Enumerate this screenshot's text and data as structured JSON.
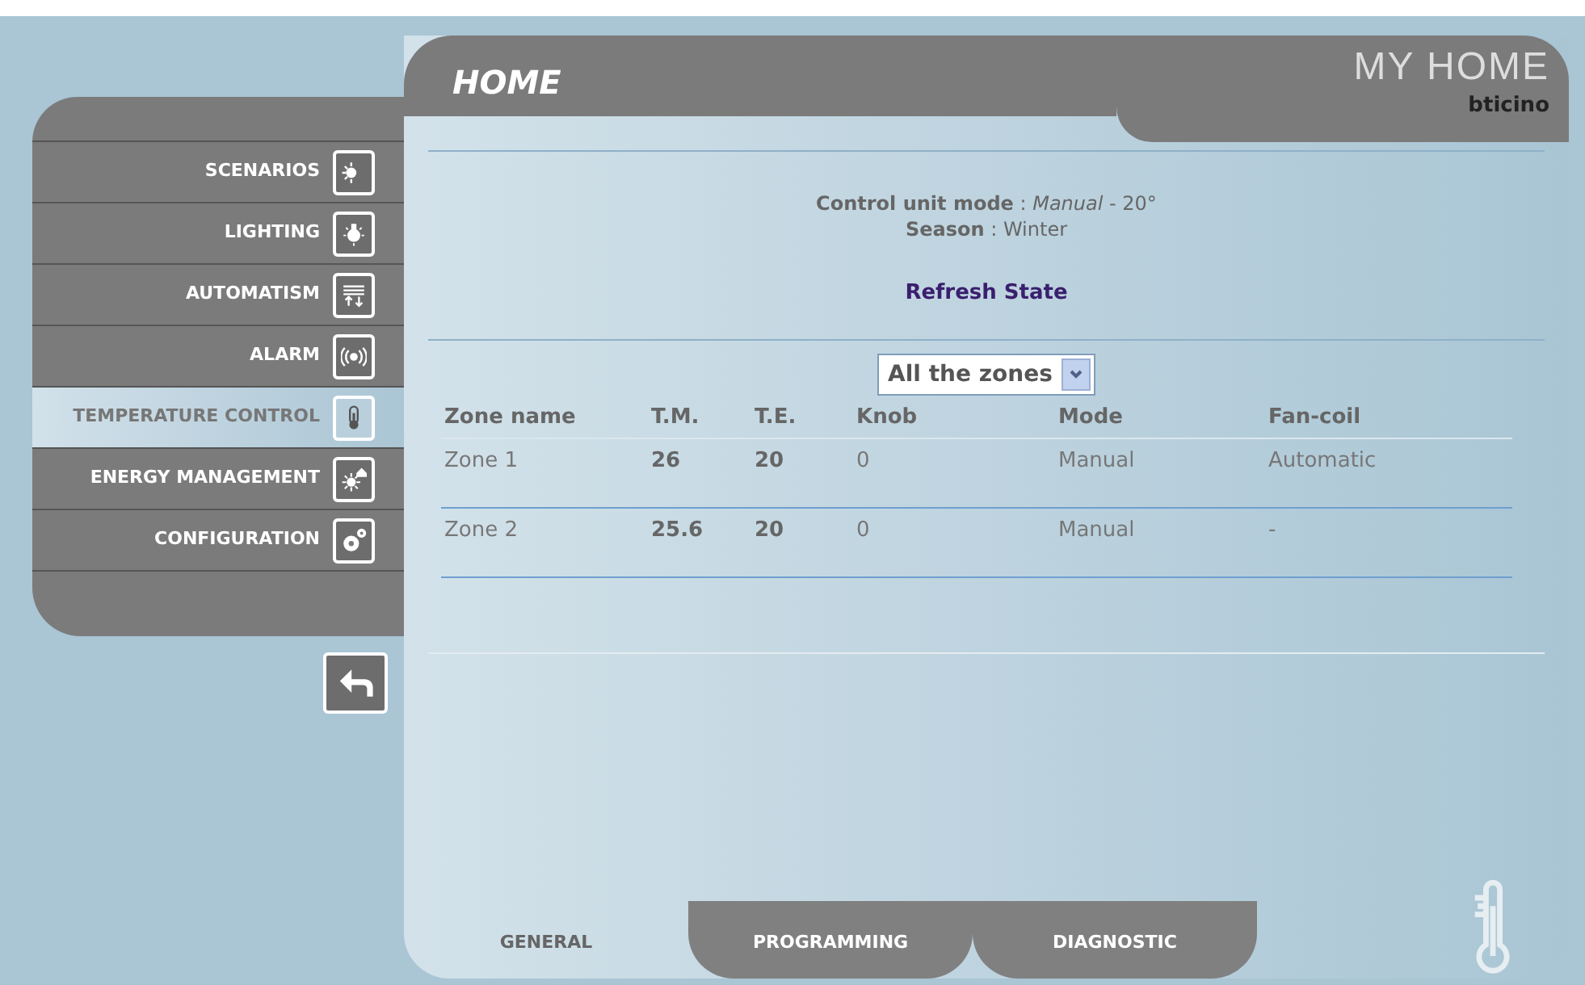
{
  "sidebar": {
    "items": [
      {
        "label": "SCENARIOS",
        "selected": false
      },
      {
        "label": "LIGHTING",
        "selected": false
      },
      {
        "label": "AUTOMATISM",
        "selected": false
      },
      {
        "label": "ALARM",
        "selected": false
      },
      {
        "label": "TEMPERATURE CONTROL",
        "selected": true
      },
      {
        "label": "ENERGY MANAGEMENT",
        "selected": false
      },
      {
        "label": "CONFIGURATION",
        "selected": false
      }
    ]
  },
  "header": {
    "title": "HOME",
    "logo": "MY HOME",
    "brand": "bticino"
  },
  "status": [
    "**Control unit mode** : *Manual* - 20°",
    "**Season** : Winter"
  ],
  "refresh_link": "Refresh State",
  "zone_select": {
    "value": "All the zones"
  },
  "table": {
    "columns": [
      "Zone name",
      "T.M.",
      "T.E.",
      "Knob",
      "Mode",
      "Fan-coil"
    ],
    "rows": [
      [
        "Zone 1",
        "26",
        "20",
        "0",
        "Manual",
        "Automatic"
      ],
      [
        "Zone 2",
        "25.6",
        "20",
        "0",
        "Manual",
        "-"
      ]
    ]
  },
  "tabs": [
    {
      "label": "GENERAL",
      "selected": true
    },
    {
      "label": "PROGRAMMING",
      "selected": false
    },
    {
      "label": "DIAGNOSTIC",
      "selected": false
    }
  ]
}
